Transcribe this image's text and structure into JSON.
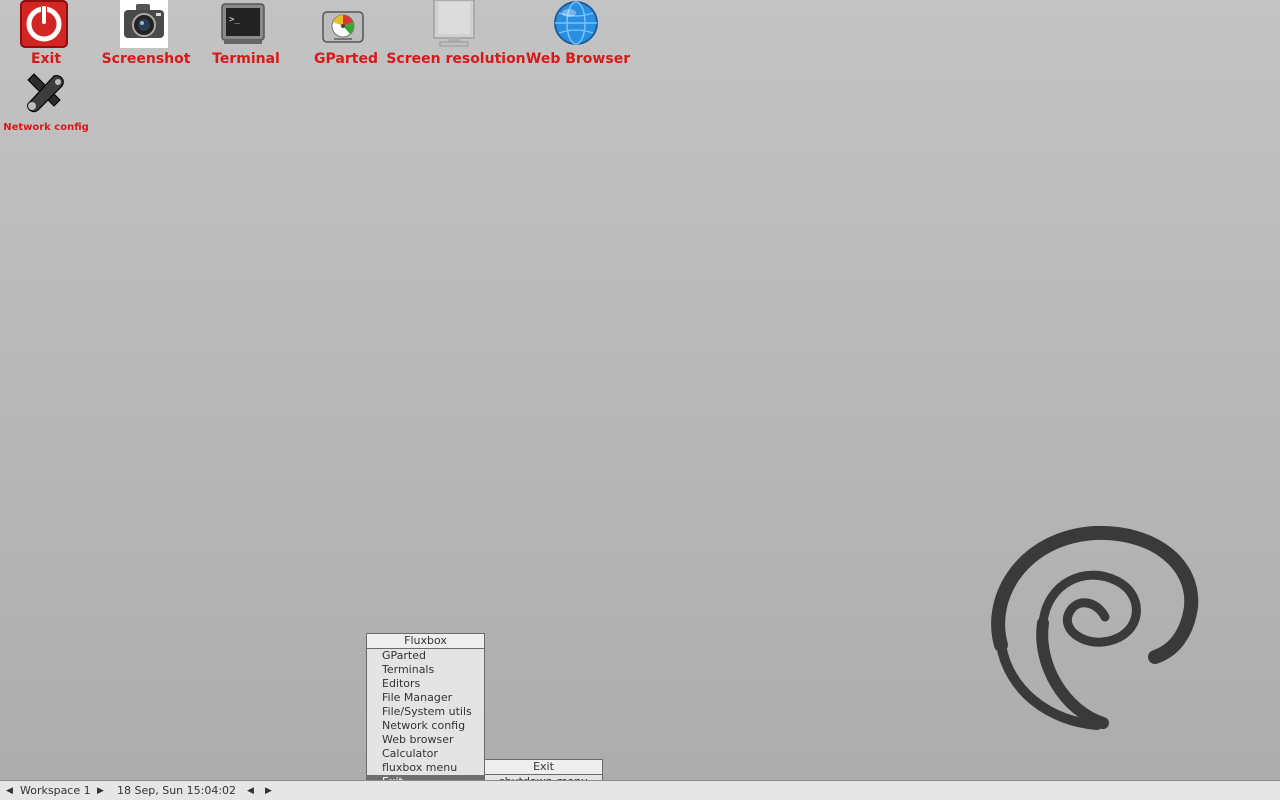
{
  "desktop": {
    "icons": [
      {
        "label": "Exit",
        "icon": "power-icon"
      },
      {
        "label": "Screenshot",
        "icon": "camera-icon"
      },
      {
        "label": "Terminal",
        "icon": "terminal-icon"
      },
      {
        "label": "GParted",
        "icon": "disk-icon"
      },
      {
        "label": "Screen resolution",
        "icon": "monitor-icon"
      },
      {
        "label": "Web Browser",
        "icon": "globe-icon"
      },
      {
        "label": "Network config",
        "icon": "tools-icon"
      }
    ],
    "label_color": "#d61a1a",
    "wallpaper_logo": "debian-swirl"
  },
  "root_menu": {
    "title": "Fluxbox",
    "items": [
      "GParted",
      "Terminals",
      "Editors",
      "File Manager",
      "File/System utils",
      "Network config",
      "Web browser",
      "Calculator",
      "fluxbox menu",
      "Exit"
    ],
    "selected": "Exit"
  },
  "submenu": {
    "title": "Exit",
    "items": [
      "shutdown-menu"
    ]
  },
  "taskbar": {
    "workspace": "Workspace 1",
    "clock": "18 Sep, Sun 15:04:02"
  }
}
